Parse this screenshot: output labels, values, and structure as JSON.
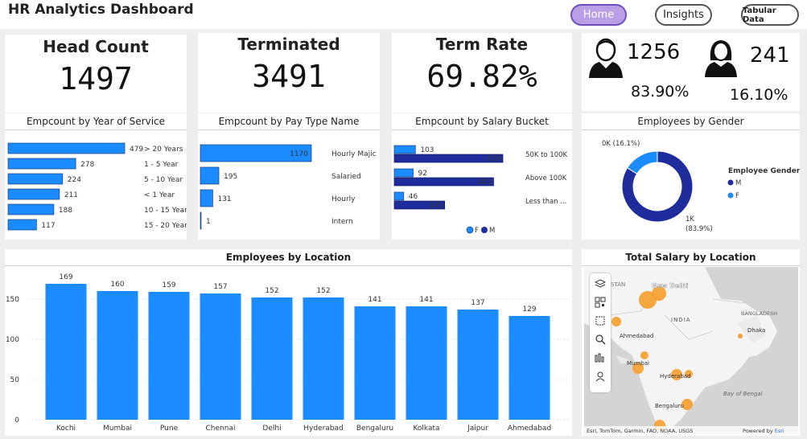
{
  "header": {
    "title": "HR Analytics Dashboard",
    "nav": [
      {
        "label": "Home",
        "active": true
      },
      {
        "label": "Insights",
        "active": false
      },
      {
        "label": "Tabular Data",
        "active": false
      }
    ]
  },
  "kpis": {
    "head_count": {
      "label": "Head Count",
      "value": "1497"
    },
    "terminated": {
      "label": "Terminated",
      "value": "3491"
    },
    "term_rate": {
      "label": "Term Rate",
      "value": "69.82%"
    }
  },
  "gender_kpi": {
    "male": {
      "count": "1256",
      "pct": "83.90%",
      "icon": "male-user-icon"
    },
    "female": {
      "count": "241",
      "pct": "16.10%",
      "icon": "female-user-icon"
    }
  },
  "colors": {
    "accent": "#1a8cff",
    "navy": "#1f2d9c",
    "orange": "#f5a623",
    "active_nav": "#b9a0e6"
  },
  "chart_data": [
    {
      "type": "bar",
      "orientation": "horizontal",
      "title": "Empcount by Year of Service",
      "categories": [
        "> 20 Years",
        "1 - 5 Year",
        "5 - 10 Year",
        "< 1 Year",
        "10 - 15 Year",
        "15 - 20 Year"
      ],
      "values": [
        479,
        278,
        224,
        211,
        188,
        117
      ]
    },
    {
      "type": "bar",
      "orientation": "horizontal",
      "title": "Empcount by Pay Type Name",
      "categories": [
        "Hourly Majic",
        "Salaried",
        "Hourly",
        "Intern"
      ],
      "values": [
        1170,
        195,
        131,
        1
      ]
    },
    {
      "type": "bar",
      "orientation": "horizontal",
      "title": "Empcount by Salary Bucket",
      "categories": [
        "50K to 100K",
        "Above 100K",
        "Less than ..."
      ],
      "series": [
        {
          "name": "F",
          "values": [
            103,
            92,
            46
          ]
        },
        {
          "name": "M",
          "values": [
            528,
            483,
            245
          ]
        }
      ],
      "legend": [
        "F",
        "M"
      ]
    },
    {
      "type": "pie",
      "donut": true,
      "title": "Employees by Gender",
      "legend_title": "Employee Gender",
      "legend": [
        "M",
        "F"
      ],
      "slices": [
        {
          "name": "M",
          "value": 83.9,
          "label": "1K",
          "pct_label": "(83.9%)"
        },
        {
          "name": "F",
          "value": 16.1,
          "label": "0K (16.1%)"
        }
      ]
    },
    {
      "type": "bar",
      "title": "Employees by Location",
      "categories": [
        "Kochi",
        "Mumbai",
        "Pune",
        "Chennai",
        "Delhi",
        "Hyderabad",
        "Bengaluru",
        "Kolkata",
        "Jaipur",
        "Ahmedabad"
      ],
      "values": [
        169,
        160,
        159,
        157,
        152,
        152,
        141,
        141,
        137,
        129
      ],
      "yticks": [
        "0",
        "50",
        "100",
        "150"
      ],
      "ylim": [
        0,
        180
      ],
      "grid": true
    }
  ],
  "map": {
    "title": "Total Salary by Location",
    "places": [
      "New Delhi",
      "Ahmedabad",
      "Mumbai",
      "Hyderabad",
      "Bengaluru",
      "Dhaka"
    ],
    "regions": [
      "INDIA",
      "BANGLADESH",
      "Bay of Bengal"
    ],
    "partial_labels": [
      "STAN"
    ],
    "attribution": "Esri, TomTom, Garmin, FAO, NOAA, USGS",
    "powered": "Powered by ",
    "powered_brand": "Esri",
    "tools": [
      "layers-icon",
      "qr-select-icon",
      "rect-select-icon",
      "search-icon",
      "heatmap-icon",
      "person-icon"
    ]
  }
}
